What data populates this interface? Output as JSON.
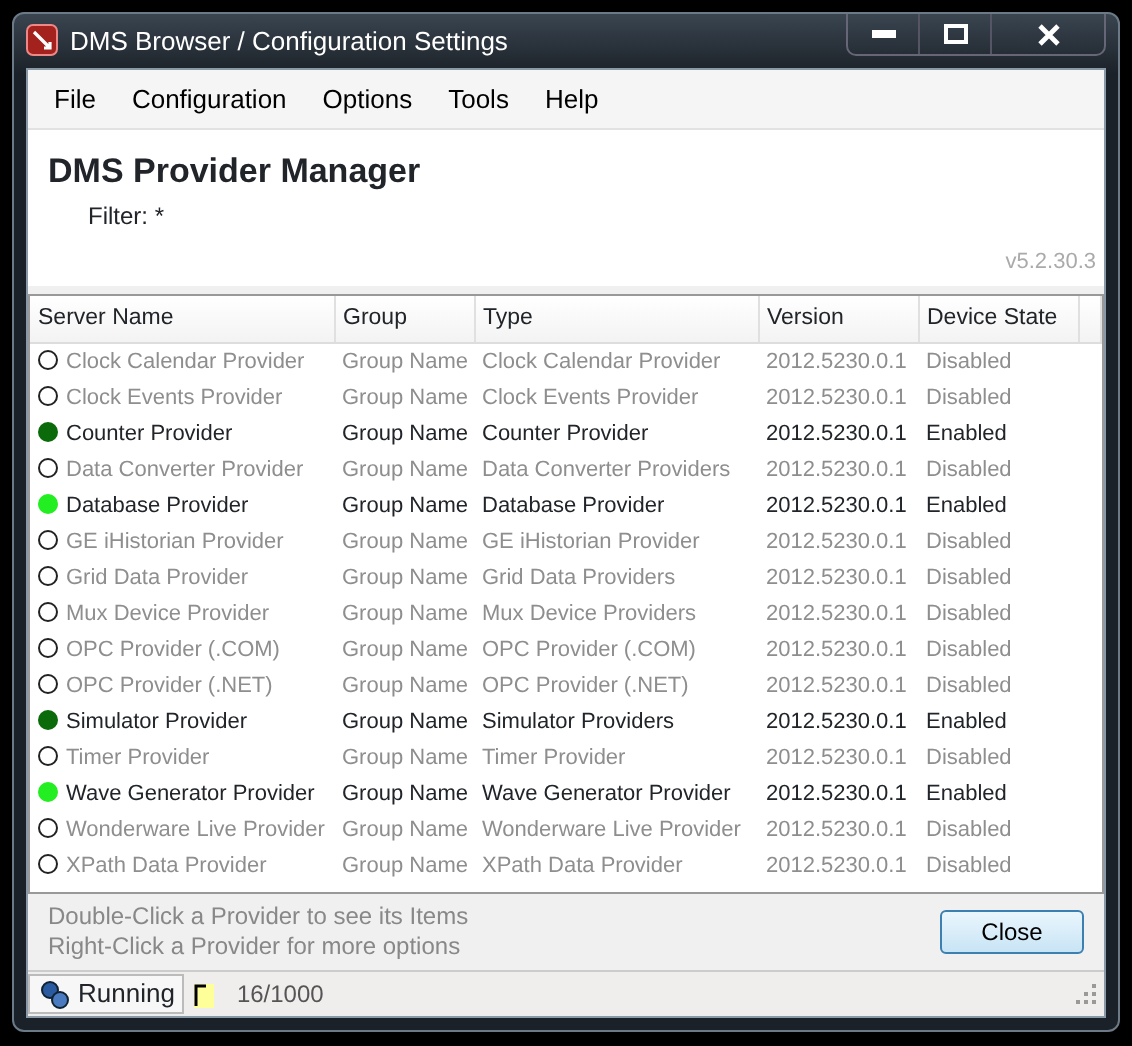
{
  "window": {
    "title": "DMS Browser / Configuration Settings"
  },
  "menu": [
    "File",
    "Configuration",
    "Options",
    "Tools",
    "Help"
  ],
  "header": {
    "title": "DMS Provider Manager",
    "filter": "Filter: *",
    "version": "v5.2.30.3"
  },
  "table": {
    "columns": [
      "Server Name",
      "Group",
      "Type",
      "Version",
      "Device State"
    ],
    "rows": [
      {
        "enabled": false,
        "cells": [
          "Clock Calendar Provider",
          "Group Name",
          "Clock Calendar Provider",
          "2012.5230.0.1",
          "Disabled"
        ]
      },
      {
        "enabled": false,
        "cells": [
          "Clock Events Provider",
          "Group Name",
          "Clock Events Provider",
          "2012.5230.0.1",
          "Disabled"
        ]
      },
      {
        "enabled": true,
        "color": "#0b6b0b",
        "cells": [
          "Counter Provider",
          "Group Name",
          "Counter Provider",
          "2012.5230.0.1",
          "Enabled"
        ]
      },
      {
        "enabled": false,
        "cells": [
          "Data Converter Provider",
          "Group Name",
          "Data Converter Providers",
          "2012.5230.0.1",
          "Disabled"
        ]
      },
      {
        "enabled": true,
        "color": "#22ee22",
        "cells": [
          "Database Provider",
          "Group Name",
          "Database Provider",
          "2012.5230.0.1",
          "Enabled"
        ]
      },
      {
        "enabled": false,
        "cells": [
          "GE iHistorian Provider",
          "Group Name",
          "GE iHistorian Provider",
          "2012.5230.0.1",
          "Disabled"
        ]
      },
      {
        "enabled": false,
        "cells": [
          "Grid Data Provider",
          "Group Name",
          "Grid Data Providers",
          "2012.5230.0.1",
          "Disabled"
        ]
      },
      {
        "enabled": false,
        "cells": [
          "Mux Device Provider",
          "Group Name",
          "Mux Device Providers",
          "2012.5230.0.1",
          "Disabled"
        ]
      },
      {
        "enabled": false,
        "cells": [
          "OPC Provider (.COM)",
          "Group Name",
          "OPC Provider (.COM)",
          "2012.5230.0.1",
          "Disabled"
        ]
      },
      {
        "enabled": false,
        "cells": [
          "OPC Provider (.NET)",
          "Group Name",
          "OPC Provider (.NET)",
          "2012.5230.0.1",
          "Disabled"
        ]
      },
      {
        "enabled": true,
        "color": "#0b6b0b",
        "cells": [
          "Simulator Provider",
          "Group Name",
          "Simulator Providers",
          "2012.5230.0.1",
          "Enabled"
        ]
      },
      {
        "enabled": false,
        "cells": [
          "Timer Provider",
          "Group Name",
          "Timer Provider",
          "2012.5230.0.1",
          "Disabled"
        ]
      },
      {
        "enabled": true,
        "color": "#22ee22",
        "cells": [
          "Wave Generator Provider",
          "Group Name",
          "Wave Generator Provider",
          "2012.5230.0.1",
          "Enabled"
        ]
      },
      {
        "enabled": false,
        "cells": [
          "Wonderware Live Provider",
          "Group Name",
          "Wonderware Live Provider",
          "2012.5230.0.1",
          "Disabled"
        ]
      },
      {
        "enabled": false,
        "cells": [
          "XPath Data Provider",
          "Group Name",
          "XPath Data Provider",
          "2012.5230.0.1",
          "Disabled"
        ]
      }
    ]
  },
  "footer": {
    "hints": [
      "Double-Click a Provider to see its Items",
      "Right-Click a Provider for more options"
    ],
    "button": "Close"
  },
  "status_bar": {
    "state": "Running",
    "count": "16/1000"
  }
}
